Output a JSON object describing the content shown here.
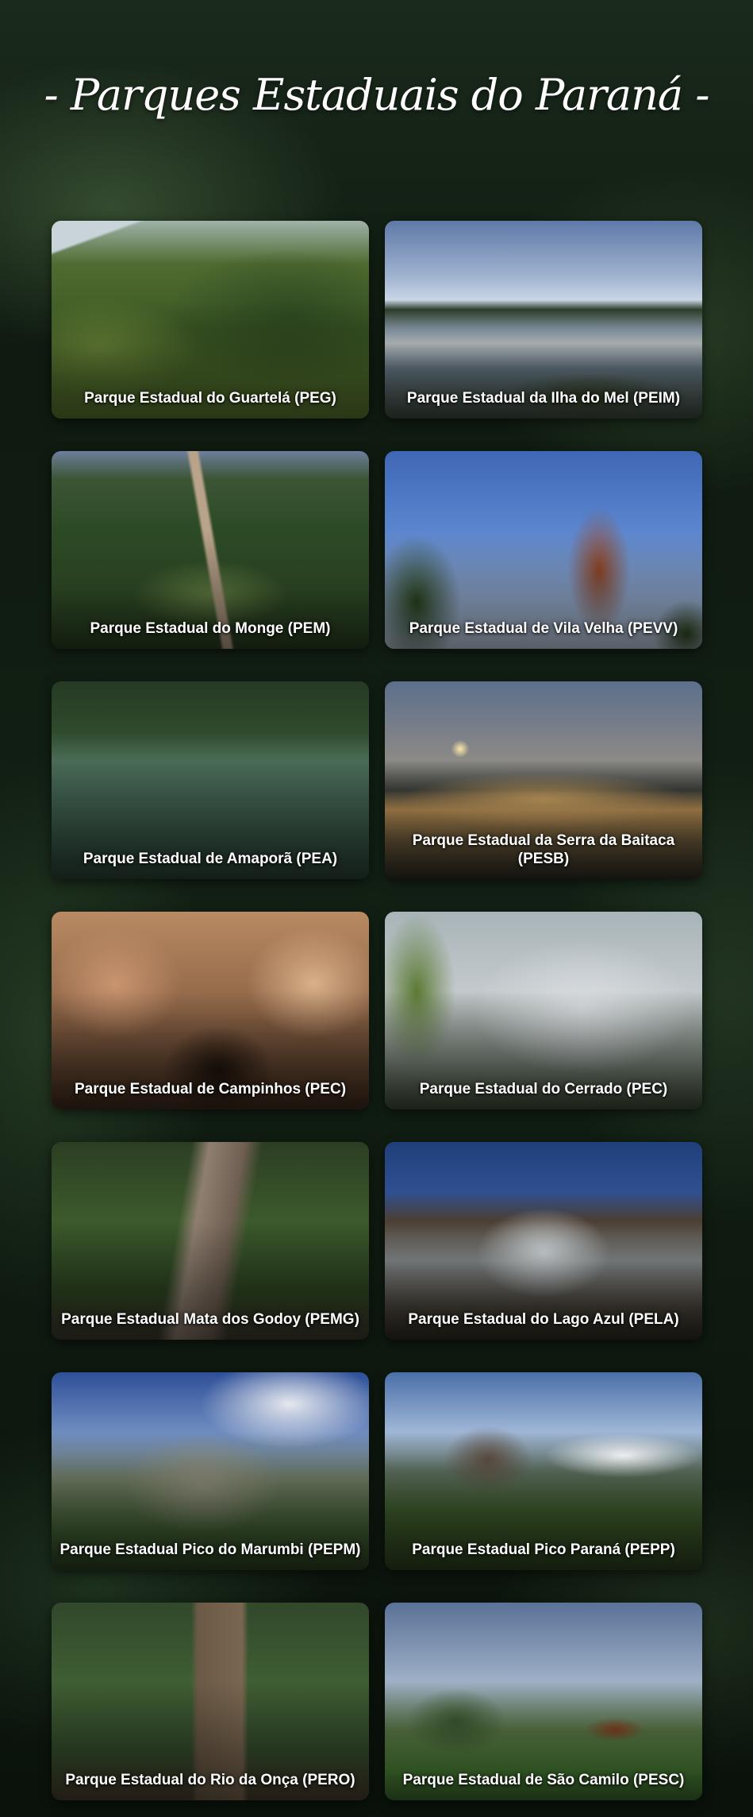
{
  "title": "- Parques Estaduais do Paraná -",
  "parks": [
    {
      "name": "Parque Estadual do Guartelá (PEG)"
    },
    {
      "name": "Parque Estadual da Ilha do Mel (PEIM)"
    },
    {
      "name": "Parque Estadual do Monge (PEM)"
    },
    {
      "name": "Parque Estadual de Vila Velha (PEVV)"
    },
    {
      "name": "Parque Estadual de Amaporã (PEA)"
    },
    {
      "name": "Parque Estadual da Serra da Baitaca (PESB)"
    },
    {
      "name": "Parque Estadual de Campinhos (PEC)"
    },
    {
      "name": "Parque Estadual do Cerrado (PEC)"
    },
    {
      "name": "Parque Estadual Mata dos Godoy (PEMG)"
    },
    {
      "name": "Parque Estadual do Lago Azul (PELA)"
    },
    {
      "name": "Parque Estadual Pico do Marumbi (PEPM)"
    },
    {
      "name": "Parque Estadual Pico Paraná (PEPP)"
    },
    {
      "name": "Parque Estadual do Rio da Onça (PERO)"
    },
    {
      "name": "Parque Estadual de São Camilo (PESC)"
    }
  ]
}
